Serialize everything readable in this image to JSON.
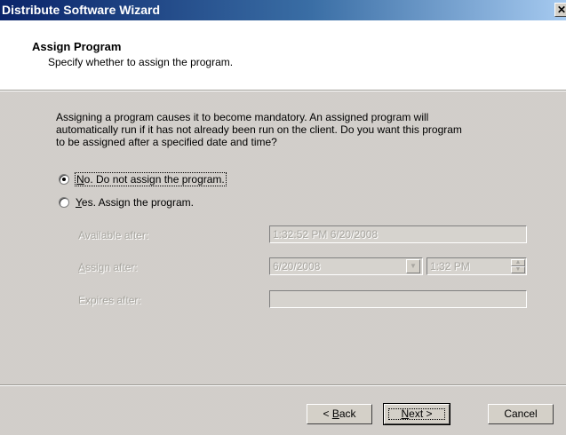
{
  "window": {
    "title": "Distribute Software Wizard",
    "close_glyph": "✕",
    "close_icon": "close-icon"
  },
  "header": {
    "title": "Assign Program",
    "subtitle": "Specify whether to assign the program."
  },
  "description": {
    "line1": "Assigning a program causes it to become mandatory. An assigned program will",
    "line2": "automatically run if it has not already been run on the client. Do you want this program",
    "line3": "to be assigned after a specified date and time?"
  },
  "options": {
    "no": {
      "mnemonic": "N",
      "rest": "o. Do not assign the program.",
      "selected": true
    },
    "yes": {
      "mnemonic": "Y",
      "rest": "es. Assign the program.",
      "selected": false
    }
  },
  "fields": {
    "available_after": {
      "label": "Available after:",
      "value": "1:32:52 PM 6/20/2008"
    },
    "assign_after": {
      "label_mnemonic": "A",
      "label_rest": "ssign after:",
      "date": "6/20/2008",
      "time": "1:32 PM",
      "dropdown_glyph": "▼",
      "spin_up_glyph": "▲",
      "spin_down_glyph": "▼"
    },
    "expires_after": {
      "label": "Expires after:",
      "value": ""
    }
  },
  "buttons": {
    "back": {
      "pre": "< ",
      "mnemonic": "B",
      "rest": "ack"
    },
    "next": {
      "mnemonic": "N",
      "rest": "ext >"
    },
    "cancel": {
      "label": "Cancel"
    }
  },
  "colors": {
    "titlebar_start": "#0a246a",
    "titlebar_end": "#a6caf0",
    "dialog_face": "#d6d3ce",
    "disabled_text": "#a8a6a0"
  }
}
